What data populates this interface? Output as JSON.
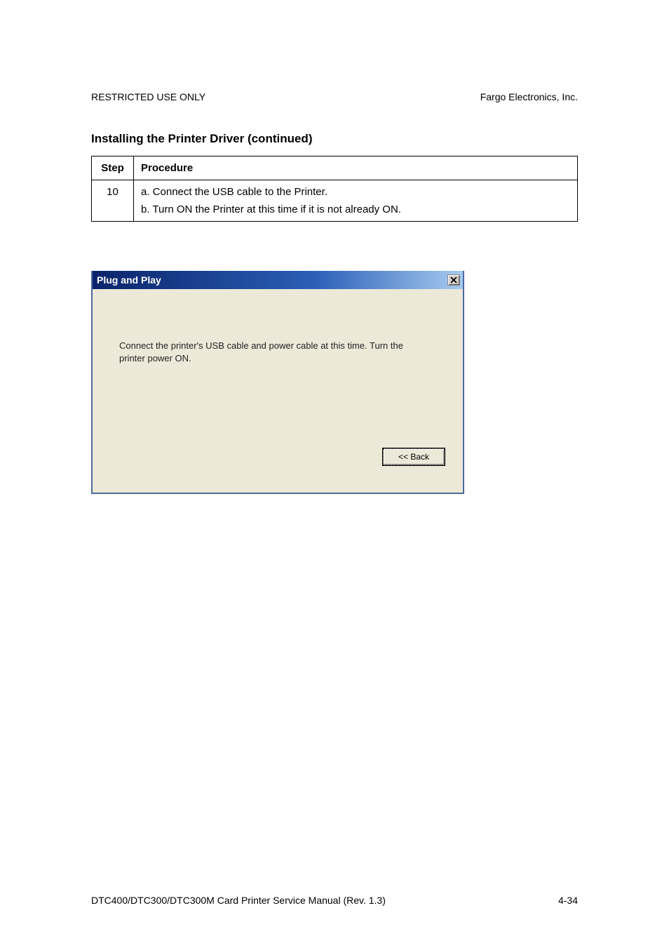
{
  "header": {
    "left": "RESTRICTED USE ONLY",
    "right": "Fargo Electronics, Inc."
  },
  "section_title": "Installing the Printer Driver (continued)",
  "table": {
    "col_step": "Step",
    "col_proc": "Procedure",
    "step_num": "10",
    "line_a": "a.   Connect the USB cable to the Printer.",
    "line_b": "b.   Turn ON the Printer at this time if it is not already ON."
  },
  "dialog": {
    "title": "Plug and Play",
    "body_text": "Connect the printer's USB cable and power cable at this time.  Turn the printer power ON.",
    "back_label": "<< Back"
  },
  "footer": {
    "left": "DTC400/DTC300/DTC300M Card Printer Service Manual (Rev. 1.3)",
    "right": "4-34"
  }
}
